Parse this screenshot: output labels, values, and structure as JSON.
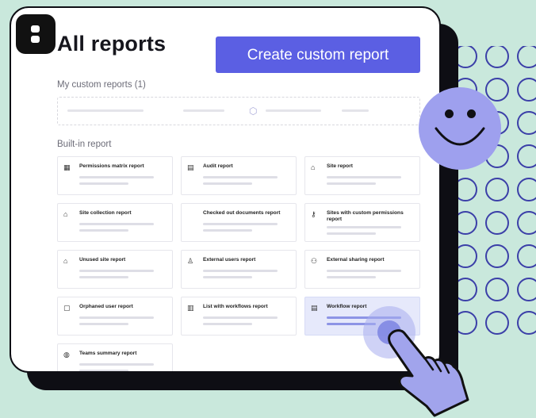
{
  "header": {
    "title": "All reports",
    "create_button": "Create custom report"
  },
  "sections": {
    "custom": "My custom reports (1)",
    "builtin": "Built-in report"
  },
  "reports": [
    {
      "label": "Permissions matrix report",
      "icon": "grid-icon"
    },
    {
      "label": "Audit report",
      "icon": "audit-icon"
    },
    {
      "label": "Site report",
      "icon": "site-icon"
    },
    {
      "label": "Site collection report",
      "icon": "site-collection-icon"
    },
    {
      "label": "Checked out documents report",
      "icon": ""
    },
    {
      "label": "Sites with custom permissions report",
      "icon": "key-icon"
    },
    {
      "label": "Unused site report",
      "icon": "unused-site-icon"
    },
    {
      "label": "External users report",
      "icon": "user-icon"
    },
    {
      "label": "External sharing report",
      "icon": "sharing-icon"
    },
    {
      "label": "Orphaned user report",
      "icon": "orphan-icon"
    },
    {
      "label": "List with workflows report",
      "icon": "list-icon"
    },
    {
      "label": "Workflow report",
      "icon": "workflow-icon",
      "selected": true
    },
    {
      "label": "Teams summary report",
      "icon": "teams-icon"
    }
  ],
  "colors": {
    "background": "#c9e8dc",
    "accent": "#5b5fe3",
    "selected_tile": "#e6e9fb",
    "smiley": "#9ea0ee",
    "rings": "#3b3fa8"
  }
}
